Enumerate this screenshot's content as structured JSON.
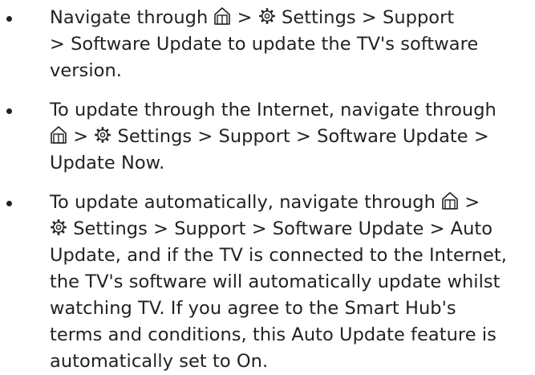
{
  "items": [
    {
      "icons": [
        "home-icon",
        "gear-icon"
      ],
      "segments": [
        "Navigate through ",
        " > ",
        " Settings > Support",
        "> Software Update to update the TV's software",
        "version."
      ]
    },
    {
      "icons": [
        "home-icon",
        "gear-icon"
      ],
      "segments": [
        "To update through the Internet, navigate through",
        " > ",
        " Settings > Support > Software Update >",
        "Update Now."
      ]
    },
    {
      "icons": [
        "home-icon",
        "gear-icon"
      ],
      "segments": [
        "To update automatically, navigate through ",
        " >",
        " Settings > Support > Software Update > Auto",
        "Update, and if the TV is connected to the Internet,",
        "the TV's software will automatically update whilst",
        "watching TV. If you agree to the Smart Hub's",
        "terms and conditions, this Auto Update feature is",
        "automatically set to On."
      ]
    }
  ],
  "colors": {
    "text": "#222222",
    "background": "#ffffff"
  }
}
